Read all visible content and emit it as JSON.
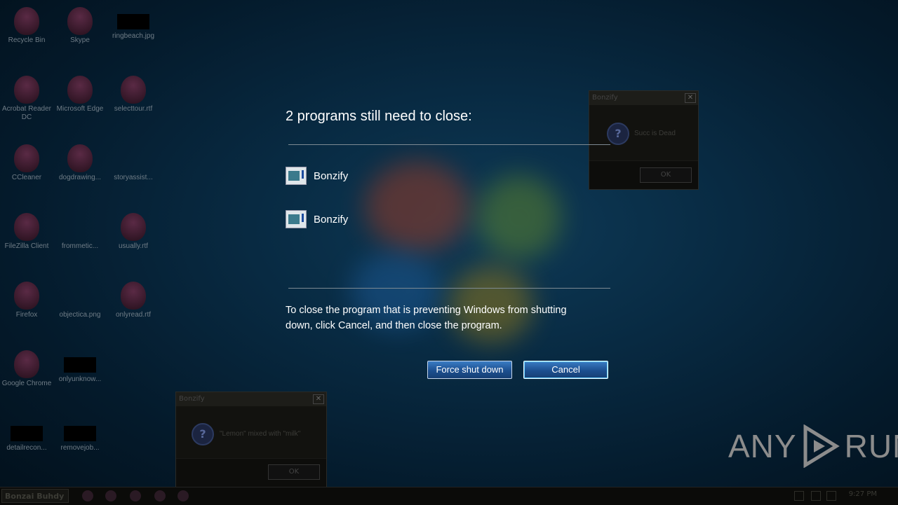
{
  "desktop_icons": [
    {
      "label": "Recycle Bin",
      "kind": "bonzi"
    },
    {
      "label": "Skype",
      "kind": "bonzi"
    },
    {
      "label": "ringbeach.jpg",
      "kind": "black"
    },
    {
      "label": "Acrobat Reader DC",
      "kind": "bonzi"
    },
    {
      "label": "Microsoft Edge",
      "kind": "bonzi"
    },
    {
      "label": "selecttour.rtf",
      "kind": "bonzi"
    },
    {
      "label": "CCleaner",
      "kind": "bonzi"
    },
    {
      "label": "dogdrawing...",
      "kind": "bonzi"
    },
    {
      "label": "storyassist...",
      "kind": "none"
    },
    {
      "label": "FileZilla Client",
      "kind": "bonzi"
    },
    {
      "label": "frommetic...",
      "kind": "none"
    },
    {
      "label": "usually.rtf",
      "kind": "bonzi"
    },
    {
      "label": "Firefox",
      "kind": "bonzi"
    },
    {
      "label": "objectica.png",
      "kind": "none"
    },
    {
      "label": "onlyread.rtf",
      "kind": "bonzi"
    },
    {
      "label": "Google Chrome",
      "kind": "bonzi"
    },
    {
      "label": "onlyunknow...",
      "kind": "black"
    },
    {
      "label": "detailrecon...",
      "kind": "black"
    },
    {
      "label": "removejob...",
      "kind": "black"
    }
  ],
  "shutdown": {
    "title": "2 programs still need to close:",
    "programs": [
      "Bonzify",
      "Bonzify"
    ],
    "message": "To close the program that is preventing Windows from shutting down, click Cancel, and then close the program.",
    "force_label": "Force shut down",
    "cancel_label": "Cancel"
  },
  "dialog_right": {
    "title": "Bonzify",
    "text": "Succ is Dead",
    "ok": "OK",
    "close": "✕",
    "q": "?"
  },
  "dialog_left": {
    "title": "Bonzify",
    "text": "\"Lemon\" mixed with \"milk\"",
    "ok": "OK",
    "close": "✕",
    "q": "?"
  },
  "taskbar": {
    "start_label": "Bonzai Buhdy",
    "clock": "9:27 PM"
  },
  "watermark": {
    "left": "ANY",
    "right": "RUN"
  }
}
